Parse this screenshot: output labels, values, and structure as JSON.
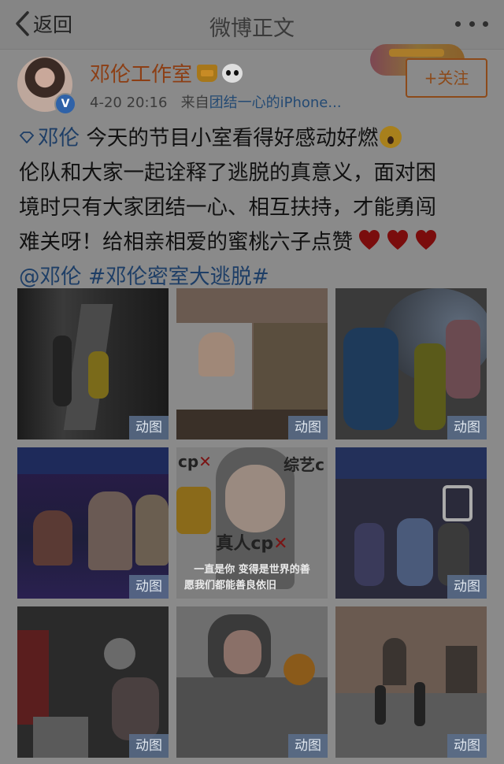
{
  "nav": {
    "back_label": "返回",
    "title": "微博正文",
    "icons": {
      "back": "chevron-left-icon",
      "more": "more-dots-icon"
    }
  },
  "post": {
    "author": "邓伦工作室",
    "time": "4-20 20:16",
    "source_prefix": "来自",
    "source": "团结一心的iPhone...",
    "follow_label": "+关注",
    "text": {
      "mention_name": "邓伦",
      "line1": " 今天的节目小室看得好感动好燃",
      "line2": "伦队和大家一起诠释了逃脱的真意义，面对困",
      "line3": "境时只有大家团结一心、相互扶持，才能勇闯",
      "line4": "难关呀！给相亲相爱的蜜桃六子点赞",
      "tag_mention": "@邓伦",
      "hashtag": "#邓伦密室大逃脱#"
    },
    "images": [
      {
        "gif_label": "动图"
      },
      {
        "gif_label": "动图"
      },
      {
        "gif_label": "动图"
      },
      {
        "gif_label": "动图"
      },
      {
        "gif_label": "动图",
        "caption_top_left": "cp",
        "caption_top_right": "综艺c",
        "caption_mid": "真人cp",
        "subtitle1": "一直是你 变得是世界的善",
        "subtitle2": "愿我们都能善良依旧"
      },
      {
        "gif_label": "动图"
      },
      {
        "gif_label": "动图"
      },
      {
        "gif_label": "动图"
      },
      {
        "gif_label": "动图"
      }
    ]
  },
  "colors": {
    "overlay_bg": "#8a8a8a",
    "author_orange": "#8c3e14",
    "link_blue": "#1e3e66",
    "gif_badge": "#5a6e8c"
  }
}
